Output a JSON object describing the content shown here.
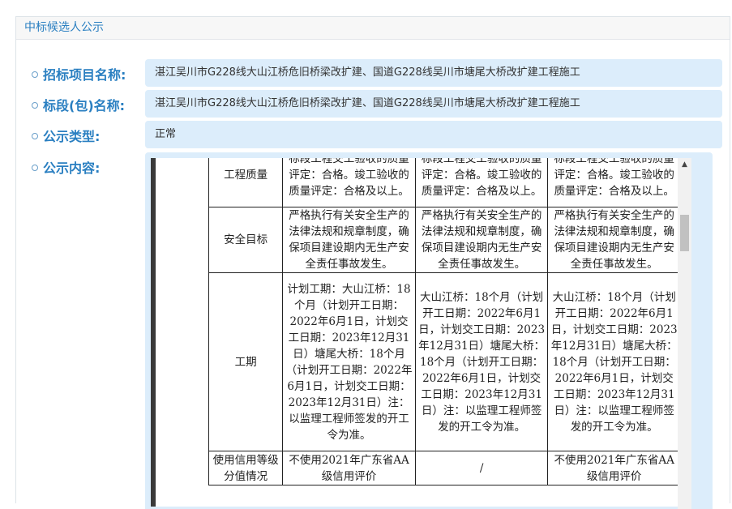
{
  "panel": {
    "title": "中标候选人公示"
  },
  "fields": [
    {
      "label": "招标项目名称:",
      "value": "湛江吴川市G228线大山江桥危旧桥梁改扩建、国道G228线吴川市塘尾大桥改扩建工程施工"
    },
    {
      "label": "标段(包)名称:",
      "value": "湛江吴川市G228线大山江桥危旧桥梁改扩建、国道G228线吴川市塘尾大桥改扩建工程施工"
    },
    {
      "label": "公示类型:",
      "value": "正常"
    },
    {
      "label": "公示内容:"
    }
  ],
  "table": {
    "rows": [
      {
        "head": "工程质量",
        "cells": [
          "标段工程交工验收的质量评定：合格。竣工验收的质量评定：合格及以上。",
          "标段工程交工验收的质量评定：合格。竣工验收的质量评定：合格及以上。",
          "标段工程交工验收的质量评定：合格。竣工验收的质量评定：合格及以上。"
        ]
      },
      {
        "head": "安全目标",
        "cells": [
          "严格执行有关安全生产的法律法规和规章制度，确保项目建设期内无生产安全责任事故发生。",
          "严格执行有关安全生产的法律法规和规章制度，确保项目建设期内无生产安全责任事故发生。",
          "严格执行有关安全生产的法律法规和规章制度，确保项目建设期内无生产安全责任事故发生。"
        ]
      },
      {
        "head": "工期",
        "cells": [
          "计划工期：大山江桥：18个月（计划开工日期：2022年6月1日，计划交工日期：2023年12月31日）塘尾大桥：18个月（计划开工日期：2022年6月1日，计划交工日期：2023年12月31日）注：以监理工程师签发的开工令为准。",
          "大山江桥：18个月（计划开工日期：2022年6月1日，计划交工日期：2023年12月31日）塘尾大桥：18个月（计划开工日期：2022年6月1日，计划交工日期：2023年12月31日）注：以监理工程师签发的开工令为准。",
          "大山江桥：18个月（计划开工日期：2022年6月1日，计划交工日期：2023年12月31日）塘尾大桥：18个月（计划开工日期：2022年6月1日，计划交工日期：2023年12月31日）注：以监理工程师签发的开工令为准。"
        ]
      },
      {
        "head": "使用信用等级分值情况",
        "cells": [
          "不使用2021年广东省AA级信用评价",
          "/",
          "不使用2021年广东省AA级信用评价"
        ]
      }
    ]
  },
  "scrollbar": {
    "up_icon": "triangle-up-icon"
  }
}
